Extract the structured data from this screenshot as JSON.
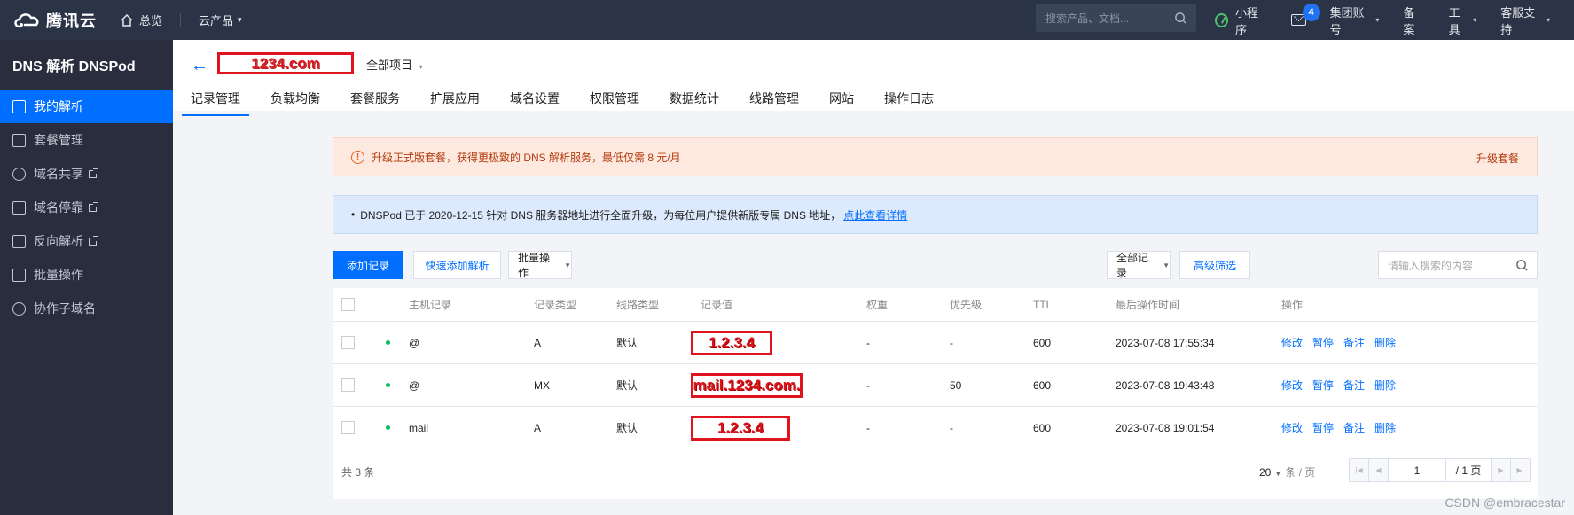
{
  "topnav": {
    "brand": "腾讯云",
    "home": "总览",
    "products": "云产品",
    "search_placeholder": "搜索产品、文档...",
    "mini_program": "小程序",
    "mail_badge": "4",
    "group_account": "集团账号",
    "record": "备案",
    "tools": "工具",
    "support": "客服支持"
  },
  "sidebar": {
    "title": "DNS 解析 DNSPod",
    "items": [
      {
        "label": "我的解析"
      },
      {
        "label": "套餐管理"
      },
      {
        "label": "域名共享"
      },
      {
        "label": "域名停靠"
      },
      {
        "label": "反向解析"
      },
      {
        "label": "批量操作"
      },
      {
        "label": "协作子域名"
      }
    ]
  },
  "header": {
    "domain": "1234.com",
    "project": "全部项目",
    "tabs": [
      "记录管理",
      "负载均衡",
      "套餐服务",
      "扩展应用",
      "域名设置",
      "权限管理",
      "数据统计",
      "线路管理",
      "网站",
      "操作日志"
    ]
  },
  "notices": {
    "warn_text": "升级正式版套餐，获得更极致的 DNS 解析服务，最低仅需 8 元/月",
    "warn_link": "升级套餐",
    "info_text": "DNSPod 已于 2020-12-15 针对 DNS 服务器地址进行全面升级，为每位用户提供新版专属 DNS 地址，",
    "info_link": "点此查看详情"
  },
  "toolbar": {
    "add": "添加记录",
    "quick_add": "快速添加解析",
    "batch": "批量操作",
    "filter_select": "全部记录",
    "advanced": "高级筛选",
    "search_placeholder": "请输入搜索的内容"
  },
  "table": {
    "columns": [
      "主机记录",
      "记录类型",
      "线路类型",
      "记录值",
      "权重",
      "优先级",
      "TTL",
      "最后操作时间",
      "操作"
    ],
    "rows": [
      {
        "host": "@",
        "type": "A",
        "line": "默认",
        "value": "1.2.3.4",
        "weight": "-",
        "priority": "-",
        "ttl": "600",
        "time": "2023-07-08 17:55:34"
      },
      {
        "host": "@",
        "type": "MX",
        "line": "默认",
        "value": "mail.1234.com.",
        "weight": "-",
        "priority": "50",
        "ttl": "600",
        "time": "2023-07-08 19:43:48"
      },
      {
        "host": "mail",
        "type": "A",
        "line": "默认",
        "value": "1.2.3.4",
        "weight": "-",
        "priority": "-",
        "ttl": "600",
        "time": "2023-07-08 19:01:54"
      }
    ],
    "ops": [
      "修改",
      "暂停",
      "备注",
      "删除"
    ],
    "total": "共 3 条",
    "page_size": "20",
    "page_size_unit": "条 / 页",
    "page": "1",
    "page_total": "/ 1 页"
  },
  "watermark": "CSDN @embracestar"
}
